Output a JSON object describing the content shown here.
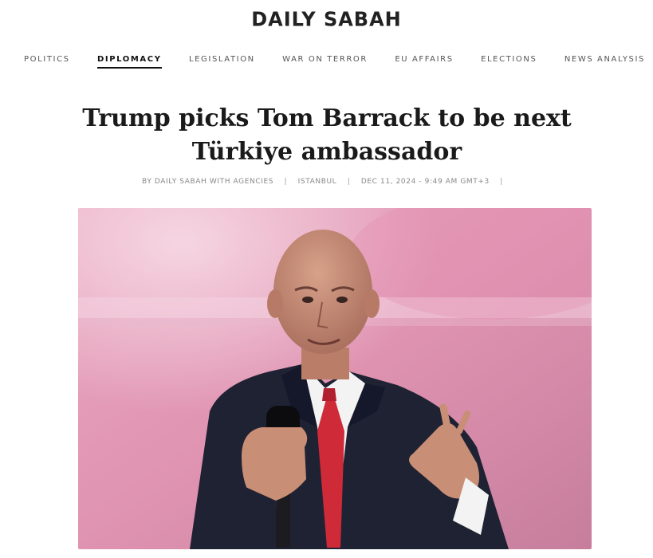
{
  "site": {
    "name": "DAILY SABAH"
  },
  "nav": {
    "items": [
      {
        "label": "POLITICS",
        "active": false
      },
      {
        "label": "DIPLOMACY",
        "active": true
      },
      {
        "label": "LEGISLATION",
        "active": false
      },
      {
        "label": "WAR ON TERROR",
        "active": false
      },
      {
        "label": "EU AFFAIRS",
        "active": false
      },
      {
        "label": "ELECTIONS",
        "active": false
      },
      {
        "label": "NEWS ANALYSIS",
        "active": false
      }
    ]
  },
  "article": {
    "headline": "Trump picks Tom Barrack to be next Türkiye ambassador",
    "byline": {
      "author": "BY DAILY SABAH WITH AGENCIES",
      "location": "ISTANBUL",
      "date": "DEC 11, 2024 - 9:49 AM GMT+3",
      "separator": "|"
    }
  },
  "colors": {
    "accent": "#111111",
    "nav_text": "#555555",
    "meta_text": "#888888"
  }
}
